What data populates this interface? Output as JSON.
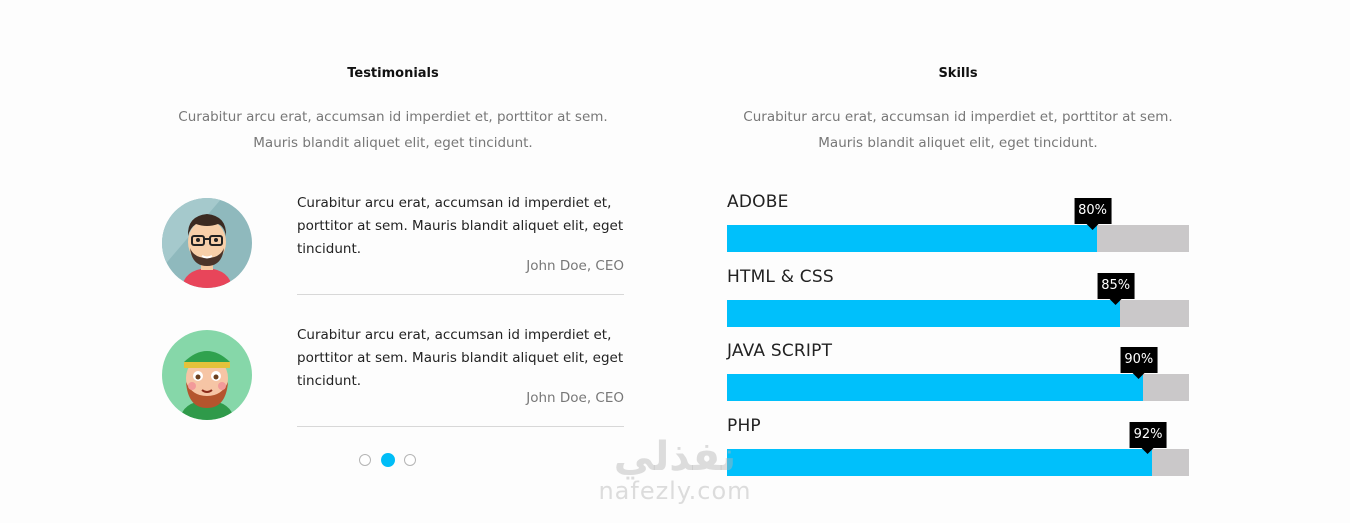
{
  "testimonials": {
    "title": "Testimonials",
    "intro_line1": "Curabitur arcu erat, accumsan id imperdiet et, porttitor at sem.",
    "intro_line2": "Mauris blandit aliquet elit, eget tincidunt.",
    "items": [
      {
        "quote_line1": "Curabitur arcu erat, accumsan id imperdiet et,",
        "quote_line2": "porttitor at sem. Mauris blandit aliquet elit, eget",
        "quote_line3": "tincidunt.",
        "author": "John Doe, CEO",
        "avatar_icon": "avatar-man-glasses-icon"
      },
      {
        "quote_line1": "Curabitur arcu erat, accumsan id imperdiet et,",
        "quote_line2": "porttitor at sem. Mauris blandit aliquet elit, eget",
        "quote_line3": "tincidunt.",
        "author": "John Doe, CEO",
        "avatar_icon": "avatar-leprechaun-icon"
      }
    ],
    "carousel": {
      "page_count": 3,
      "active_page": 2
    }
  },
  "skills": {
    "title": "Skills",
    "intro_line1": "Curabitur arcu erat, accumsan id imperdiet et, porttitor at sem.",
    "intro_line2": "Mauris blandit aliquet elit, eget tincidunt.",
    "items": [
      {
        "label": "ADOBE",
        "percent": 80,
        "percent_label": "80%"
      },
      {
        "label": "HTML & CSS",
        "percent": 85,
        "percent_label": "85%"
      },
      {
        "label": "JAVA SCRIPT",
        "percent": 90,
        "percent_label": "90%"
      },
      {
        "label": "PHP",
        "percent": 92,
        "percent_label": "92%"
      }
    ]
  },
  "watermark": {
    "arabic": "نفذلي",
    "latin": "nafezly.com"
  },
  "colors": {
    "accent": "#00c0fb",
    "track": "#cac8c9",
    "tooltip": "#000000",
    "muted_text": "#777777"
  }
}
